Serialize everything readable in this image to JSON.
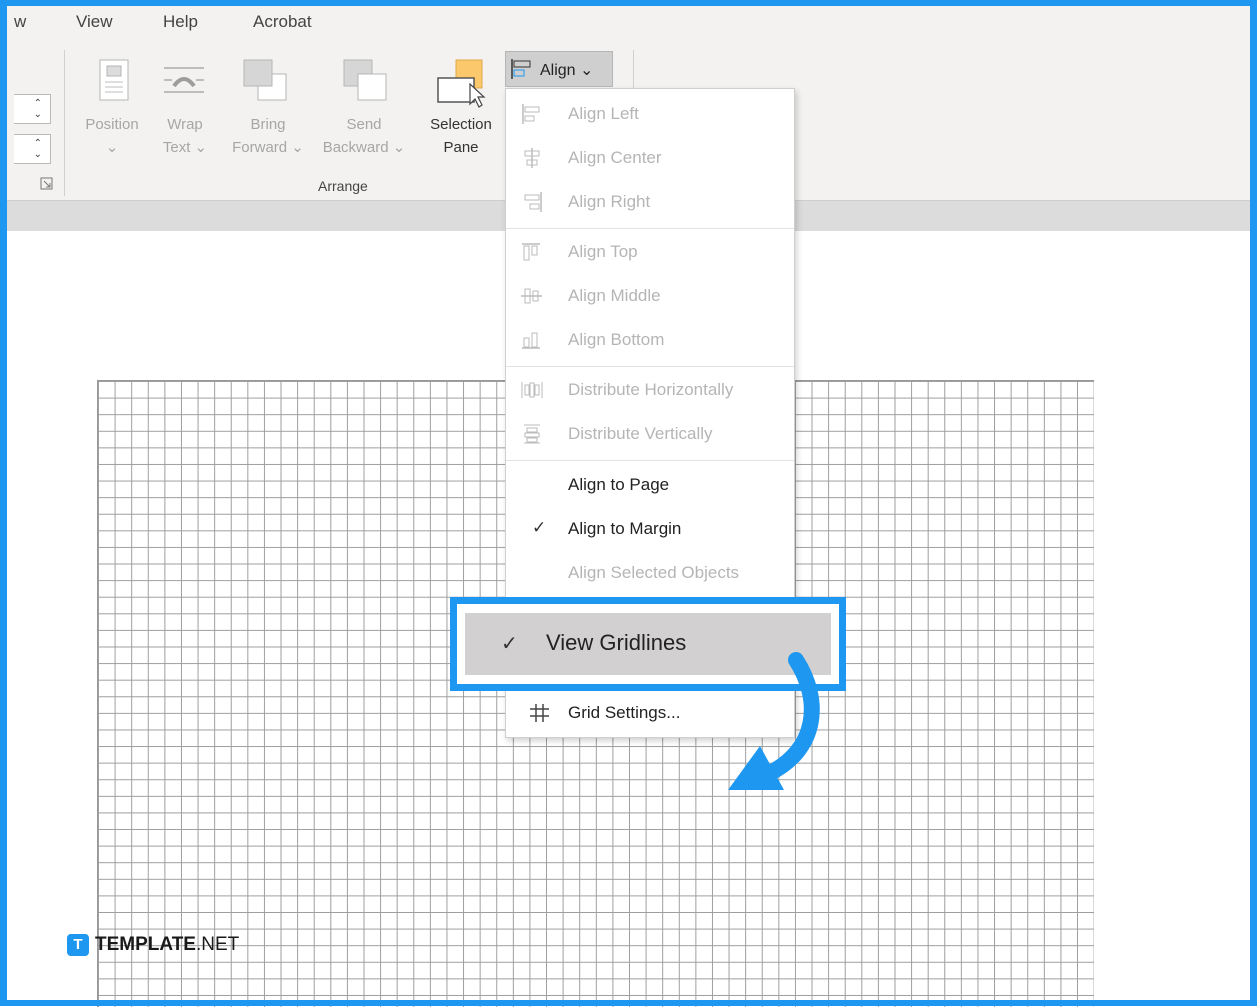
{
  "menu_tabs": [
    "w",
    "View",
    "Help",
    "Acrobat"
  ],
  "ribbon": {
    "buttons": [
      {
        "label1": "Position",
        "label2": "⌄",
        "icon": "position-icon"
      },
      {
        "label1": "Wrap",
        "label2": "Text ⌄",
        "icon": "wrap-text-icon"
      },
      {
        "label1": "Bring",
        "label2": "Forward ⌄",
        "icon": "bring-forward-icon"
      },
      {
        "label1": "Send",
        "label2": "Backward ⌄",
        "icon": "send-backward-icon"
      },
      {
        "label1": "Selection",
        "label2": "Pane",
        "icon": "selection-pane-icon"
      }
    ],
    "group_label": "Arrange",
    "align_button": "Align ⌄"
  },
  "align_menu": {
    "items": [
      {
        "label": "Align Left",
        "icon": "align-left-icon",
        "enabled": false
      },
      {
        "label": "Align Center",
        "icon": "align-center-icon",
        "enabled": false
      },
      {
        "label": "Align Right",
        "icon": "align-right-icon",
        "enabled": false
      },
      {
        "label": "Align Top",
        "icon": "align-top-icon",
        "enabled": false
      },
      {
        "label": "Align Middle",
        "icon": "align-middle-icon",
        "enabled": false
      },
      {
        "label": "Align Bottom",
        "icon": "align-bottom-icon",
        "enabled": false
      },
      {
        "label": "Distribute Horizontally",
        "icon": "distribute-horizontally-icon",
        "enabled": false
      },
      {
        "label": "Distribute Vertically",
        "icon": "distribute-vertically-icon",
        "enabled": false
      },
      {
        "label": "Align to Page",
        "enabled": true,
        "checked": false
      },
      {
        "label": "Align to Margin",
        "enabled": true,
        "checked": true
      },
      {
        "label": "Align Selected Objects",
        "enabled": false
      },
      {
        "label": "View Gridlines",
        "enabled": true,
        "checked": true,
        "highlighted": true
      },
      {
        "label": "Grid Settings...",
        "icon": "grid-icon",
        "enabled": true
      }
    ],
    "check_mark": "✓"
  },
  "watermark": {
    "badge": "T",
    "brand": "TEMPLATE",
    "suffix": ".NET"
  },
  "colors": {
    "accent": "#1d97f0",
    "highlight": "#d2d0d0",
    "disabled": "#b5b5b5"
  }
}
